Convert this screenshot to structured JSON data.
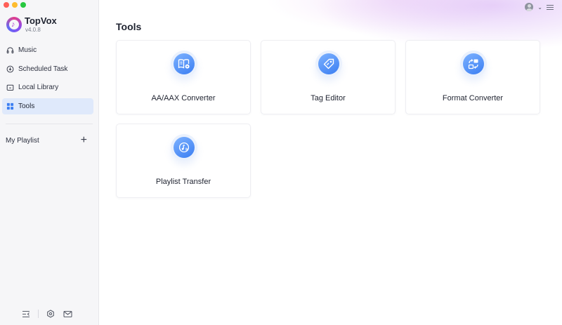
{
  "app": {
    "name": "TopVox",
    "version": "v4.0.8"
  },
  "sidebar": {
    "items": [
      {
        "label": "Music",
        "icon": "headphones-icon"
      },
      {
        "label": "Scheduled Task",
        "icon": "download-clock-icon"
      },
      {
        "label": "Local Library",
        "icon": "folder-icon"
      },
      {
        "label": "Tools",
        "icon": "grid-icon",
        "active": true
      }
    ],
    "playlist_label": "My Playlist",
    "playlist_add": "+"
  },
  "header": {
    "user_icon": "user-avatar-icon",
    "chevron": "⌄",
    "menu_icon": "hamburger-menu-icon"
  },
  "main": {
    "title": "Tools",
    "tools": [
      {
        "label": "AA/AAX Converter",
        "icon": "audiobook-icon"
      },
      {
        "label": "Tag Editor",
        "icon": "tag-icon"
      },
      {
        "label": "Format Converter",
        "icon": "convert-icon"
      },
      {
        "label": "Playlist Transfer",
        "icon": "playlist-transfer-icon"
      }
    ]
  },
  "colors": {
    "accent": "#3b7ef2",
    "active_nav_bg": "#dfe9fb",
    "sidebar_bg": "#f6f6f8"
  }
}
